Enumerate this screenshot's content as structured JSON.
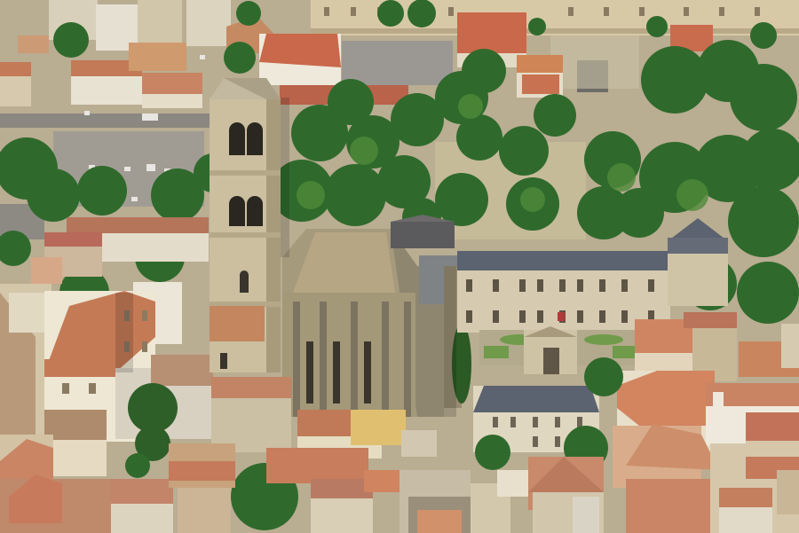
{
  "image": {
    "kind": "aerial-photograph",
    "subject": "medieval-gothic-church-with-bell-tower-in-old-town",
    "palette": {
      "stone": "#cfc3a6",
      "stone_shadow": "#8f8670",
      "roof_tile": "#c9734f",
      "roof_tile_dark": "#a4573a",
      "slate": "#5b6270",
      "tree": "#2f6a2c",
      "tree_light": "#4f8a3a",
      "road": "#8d8a83",
      "lawn": "#6f9b4a"
    }
  }
}
